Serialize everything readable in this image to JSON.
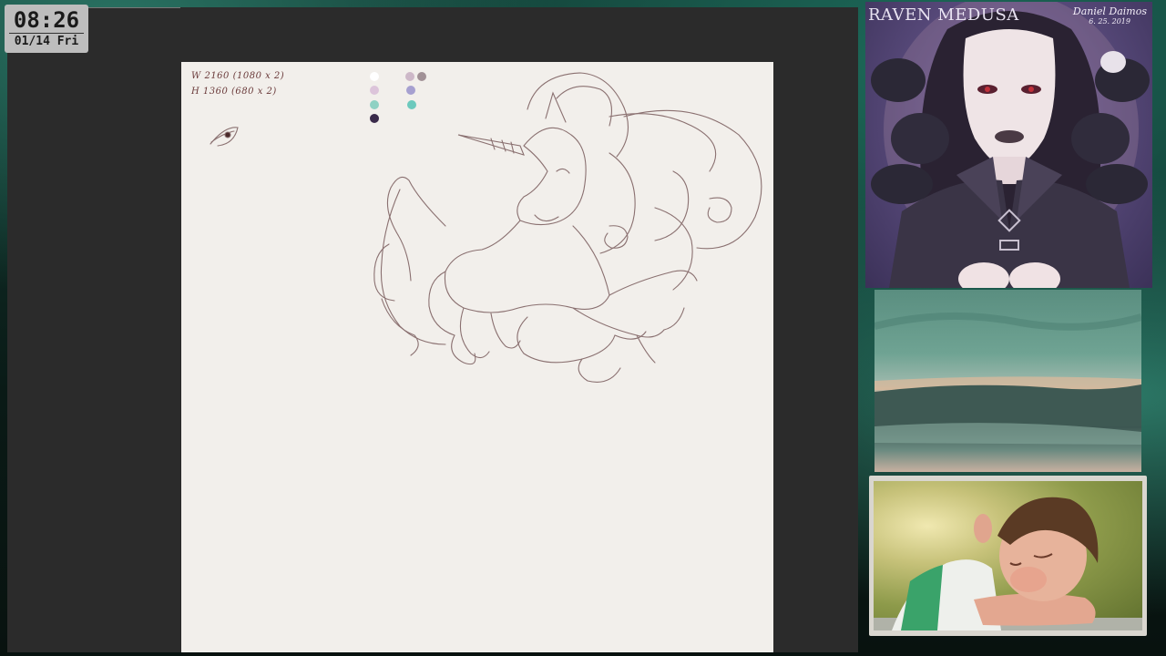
{
  "clock": {
    "time": "08:26",
    "date": "01/14 Fri"
  },
  "canvas": {
    "width_note": "W 2160 (1080 x 2)",
    "height_note": "H 1360 (680 x 2)",
    "palette": [
      "#ffffff",
      "#cdb8c8",
      "#dcc4da",
      "#8fd1c3",
      "#3a2a4a",
      "#c8b7c3",
      "#a19196",
      "#a6a0d0",
      "#6cc9bd"
    ]
  },
  "reference": {
    "title": "RAVEN MEDUSA",
    "signature": "Daniel Daimos",
    "date": "6. 25. 2019"
  }
}
